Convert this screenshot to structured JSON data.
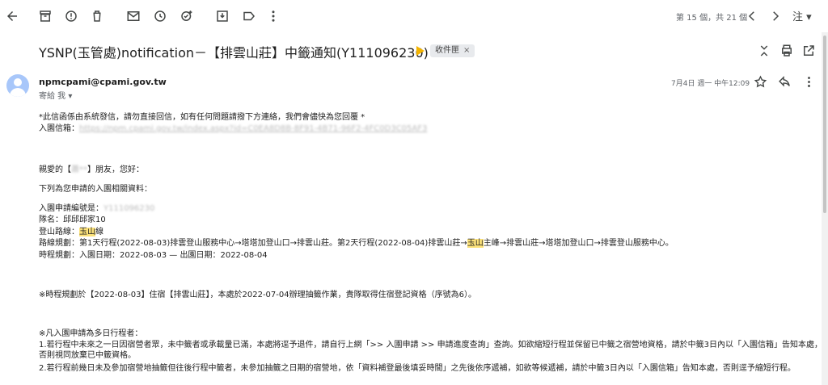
{
  "toolbar": {
    "pager": "第 15 個，共 21 個",
    "lang": "注"
  },
  "subject": {
    "title": "YSNP(玉管處)notification－【排雲山莊】中籤通知(Y111096230)",
    "label": "收件匣",
    "label_close": "×"
  },
  "message": {
    "sender": "npmcpami@cpami.gov.tw",
    "to_me": "寄給 我 ▾",
    "date": "7月4日 週一 中午12:09"
  },
  "body": {
    "line1": "*此信函係由系統發信，請勿直接回信，如有任何問題請撥下方連絡，我們會儘快為您回覆 *",
    "line2_label": "入園信箱：",
    "line2_link": "https://npm.cpami.gov.tw/index.aspx?id=C0EA8D8B-8F91-4B71-96F2-4FC0D3C05AF3",
    "greeting_pre": "親愛的【",
    "greeting_name": "蕭**",
    "greeting_post": "】朋友，您好：",
    "intro": "下列為您申請的入園相關資料：",
    "app_no_label": "入園申請編號是：",
    "app_no_value": "Y111096230",
    "team": "隊名：邱邱邱家10",
    "route_label": "登山路線：",
    "route_hl": "玉山",
    "route_suffix": "線",
    "plan_pre": "路線規劃：第1天行程(2022-08-03)排雲登山服務中心→塔塔加登山口→排雲山莊。第2天行程(2022-08-04)排雲山莊→",
    "plan_hl": "玉山",
    "plan_post": "主峰→排雲山莊→塔塔加登山口→排雲登山服務中心。",
    "schedule": "時程規劃：入園日期：2022-08-03 — 出園日期：2022-08-04",
    "notice": "※時程規劃於【2022-08-03】住宿【排雲山莊】，本處於2022-07-04辦理抽籤作業，貴隊取得住宿登記資格（序號為6）。",
    "multi_title": "※凡入園申請為多日行程者：",
    "multi_1": "1.若行程中未來之一日因宿營者眾，未中籤者或承載量已滿，本處將逕予退件，請自行上網「>> 入園申請 >> 申請進度查詢」查詢。如欲縮短行程並保留已中籤之宿營地資格，請於中籤3日內以「入園信箱」告知本處，否則視同放棄已中籤資格。",
    "multi_2": "2.若行程前幾日未及參加宿營地抽籤但往後行程中籤者，未參加抽籤之日期的宿營地，依「資料補登最後填妥時間」之先後依序遞補，如欲等候遞補，請於中籤3日內以「入園信箱」告知本處，否則逕予縮短行程。"
  },
  "icons": [
    "back-icon",
    "archive-icon",
    "report-spam-icon",
    "delete-icon",
    "mail-icon",
    "snooze-icon",
    "add-task-icon",
    "move-to-icon",
    "label-icon",
    "more-vert-icon",
    "chevron-left-icon",
    "chevron-right-icon",
    "collapse-icon",
    "print-icon",
    "open-new-window-icon",
    "star-icon",
    "reply-icon",
    "more-vert-message-icon"
  ]
}
